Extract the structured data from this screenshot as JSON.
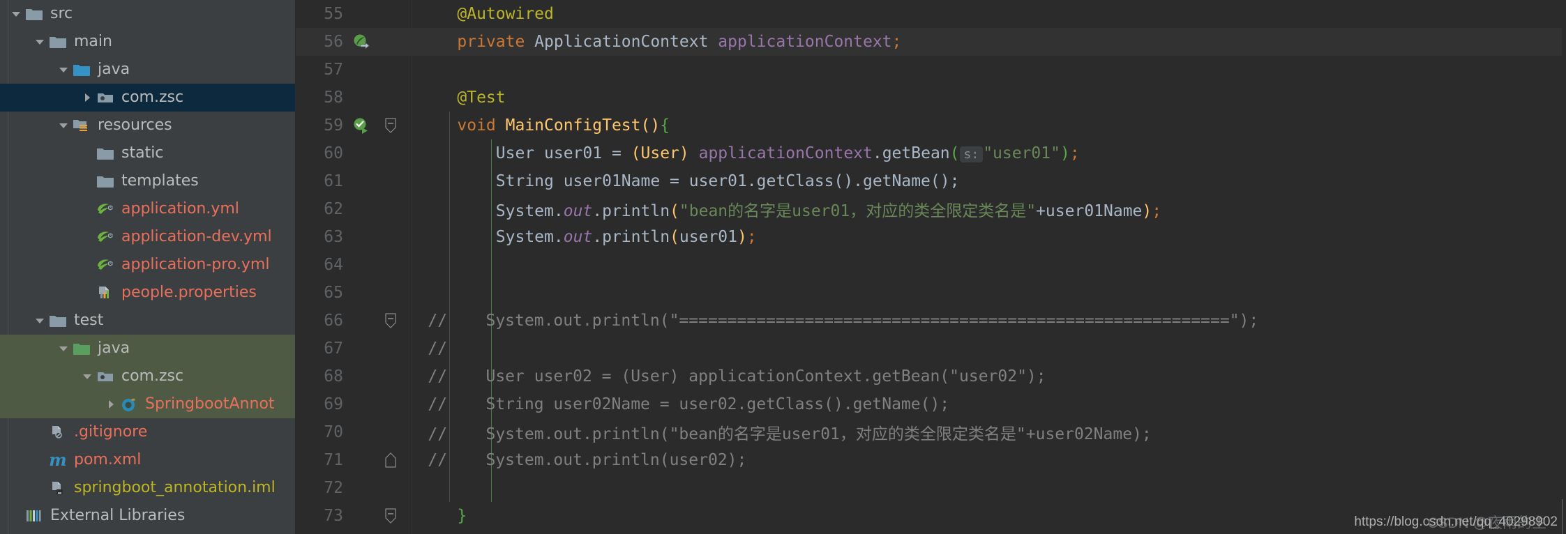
{
  "sidebar": {
    "rows": [
      {
        "label": "src",
        "depth": 0,
        "arrow": "down",
        "icon": "folder-grey",
        "color": "grey",
        "state": "none"
      },
      {
        "label": "main",
        "depth": 1,
        "arrow": "down",
        "icon": "folder-grey",
        "color": "grey",
        "state": "none"
      },
      {
        "label": "java",
        "depth": 2,
        "arrow": "down",
        "icon": "folder-blue",
        "color": "grey",
        "state": "none"
      },
      {
        "label": "com.zsc",
        "depth": 3,
        "arrow": "right",
        "icon": "package",
        "color": "grey",
        "state": "selected-blue"
      },
      {
        "label": "resources",
        "depth": 2,
        "arrow": "down",
        "icon": "folder-res",
        "color": "grey",
        "state": "none"
      },
      {
        "label": "static",
        "depth": 3,
        "arrow": "none",
        "icon": "folder-grey",
        "color": "grey",
        "state": "none"
      },
      {
        "label": "templates",
        "depth": 3,
        "arrow": "none",
        "icon": "folder-grey",
        "color": "grey",
        "state": "none"
      },
      {
        "label": "application.yml",
        "depth": 3,
        "arrow": "none",
        "icon": "spring-yml",
        "color": "salmon",
        "state": "none"
      },
      {
        "label": "application-dev.yml",
        "depth": 3,
        "arrow": "none",
        "icon": "spring-yml",
        "color": "salmon",
        "state": "none"
      },
      {
        "label": "application-pro.yml",
        "depth": 3,
        "arrow": "none",
        "icon": "spring-yml",
        "color": "salmon",
        "state": "none"
      },
      {
        "label": "people.properties",
        "depth": 3,
        "arrow": "none",
        "icon": "properties",
        "color": "salmon",
        "state": "none"
      },
      {
        "label": "test",
        "depth": 1,
        "arrow": "down",
        "icon": "folder-grey",
        "color": "grey",
        "state": "none"
      },
      {
        "label": "java",
        "depth": 2,
        "arrow": "down",
        "icon": "folder-green",
        "color": "grey",
        "state": "selected-green"
      },
      {
        "label": "com.zsc",
        "depth": 3,
        "arrow": "down",
        "icon": "package",
        "color": "grey",
        "state": "selected-green"
      },
      {
        "label": "SpringbootAnnot",
        "depth": 4,
        "arrow": "right",
        "icon": "spring-class",
        "color": "salmon",
        "state": "selected-green"
      },
      {
        "label": ".gitignore",
        "depth": 1,
        "arrow": "none",
        "icon": "gitignore",
        "color": "salmon",
        "state": "none"
      },
      {
        "label": "pom.xml",
        "depth": 1,
        "arrow": "none",
        "icon": "maven",
        "color": "salmon",
        "state": "none"
      },
      {
        "label": "springboot_annotation.iml",
        "depth": 1,
        "arrow": "none",
        "icon": "iml",
        "color": "olive",
        "state": "none"
      },
      {
        "label": "External Libraries",
        "depth": 0,
        "arrow": "none",
        "icon": "libraries",
        "color": "grey",
        "state": "none"
      }
    ]
  },
  "editor": {
    "lines": [
      {
        "num": "55",
        "gicon": "none",
        "fold": "none",
        "caret": false
      },
      {
        "num": "56",
        "gicon": "bean-arrow",
        "fold": "none",
        "caret": true
      },
      {
        "num": "57",
        "gicon": "none",
        "fold": "none",
        "caret": false
      },
      {
        "num": "58",
        "gicon": "none",
        "fold": "none",
        "caret": false
      },
      {
        "num": "59",
        "gicon": "run-test",
        "fold": "collapse",
        "caret": false
      },
      {
        "num": "60",
        "gicon": "none",
        "fold": "none",
        "caret": false
      },
      {
        "num": "61",
        "gicon": "none",
        "fold": "none",
        "caret": false
      },
      {
        "num": "62",
        "gicon": "none",
        "fold": "none",
        "caret": false
      },
      {
        "num": "63",
        "gicon": "none",
        "fold": "none",
        "caret": false
      },
      {
        "num": "64",
        "gicon": "none",
        "fold": "none",
        "caret": false
      },
      {
        "num": "65",
        "gicon": "none",
        "fold": "none",
        "caret": false
      },
      {
        "num": "66",
        "gicon": "none",
        "fold": "collapse",
        "caret": false
      },
      {
        "num": "67",
        "gicon": "none",
        "fold": "none",
        "caret": false
      },
      {
        "num": "68",
        "gicon": "none",
        "fold": "none",
        "caret": false
      },
      {
        "num": "69",
        "gicon": "none",
        "fold": "none",
        "caret": false
      },
      {
        "num": "70",
        "gicon": "none",
        "fold": "none",
        "caret": false
      },
      {
        "num": "71",
        "gicon": "none",
        "fold": "end",
        "caret": false
      },
      {
        "num": "72",
        "gicon": "none",
        "fold": "none",
        "caret": false
      },
      {
        "num": "73",
        "gicon": "none",
        "fold": "collapse",
        "caret": false
      }
    ],
    "code": {
      "l55_annotation": "@Autowired",
      "l56_kw": "private ",
      "l56_type": "ApplicationContext ",
      "l56_field": "applicationContext",
      "l56_semi": ";",
      "l58_annotation": "@Test",
      "l59_kw": "void ",
      "l59_method": "MainConfigTest",
      "l59_paren": "()",
      "l59_brace": "{",
      "l60_a": "User user01 = ",
      "l60_cast": "(User)",
      "l60_b": " ",
      "l60_ctx": "applicationContext",
      "l60_c": ".getBean",
      "l60_open": "(",
      "l60_hint": "s:",
      "l60_str": "\"user01\"",
      "l60_close": ")",
      "l60_semi": ";",
      "l61": "String user01Name = user01.getClass().getName();",
      "l62_a": "System.",
      "l62_out": "out",
      "l62_b": ".println",
      "l62_open": "(",
      "l62_str": "\"bean的名字是user01，对应的类全限定类名是\"",
      "l62_plus": "+user01Name",
      "l62_close": ")",
      "l62_semi": ";",
      "l63_a": "System.",
      "l63_out": "out",
      "l63_b": ".println",
      "l63_open": "(",
      "l63_arg": "user01",
      "l63_close": ")",
      "l63_semi": ";",
      "l66_slashes": "//",
      "l66_text": "    System.out.println(\"=========================================================\");",
      "l67_slashes": "//",
      "l67_text": "",
      "l68_slashes": "//",
      "l68_text": "    User user02 = (User) applicationContext.getBean(\"user02\");",
      "l69_slashes": "//",
      "l69_text": "    String user02Name = user02.getClass().getName();",
      "l70_slashes": "//",
      "l70_text": "    System.out.println(\"bean的名字是user01，对应的类全限定类名是\"+user02Name);",
      "l71_slashes": "//",
      "l71_text": "    System.out.println(user02);",
      "l73_brace": "}"
    }
  },
  "watermark": {
    "url": "https://blog.csdn.net/qq_40298902",
    "cn": "CSDN @夜雨的主"
  },
  "colors": {
    "bg_editor": "#2b2b2b",
    "bg_sidebar": "#3c3f41",
    "selection_blue": "#0d293e",
    "selection_green": "#4e5a44",
    "annotation": "#bbb529",
    "keyword": "#cc7832",
    "string": "#6a8759",
    "field": "#9876aa",
    "method": "#ffc66d",
    "comment": "#808080",
    "plain": "#a9b7c6"
  }
}
